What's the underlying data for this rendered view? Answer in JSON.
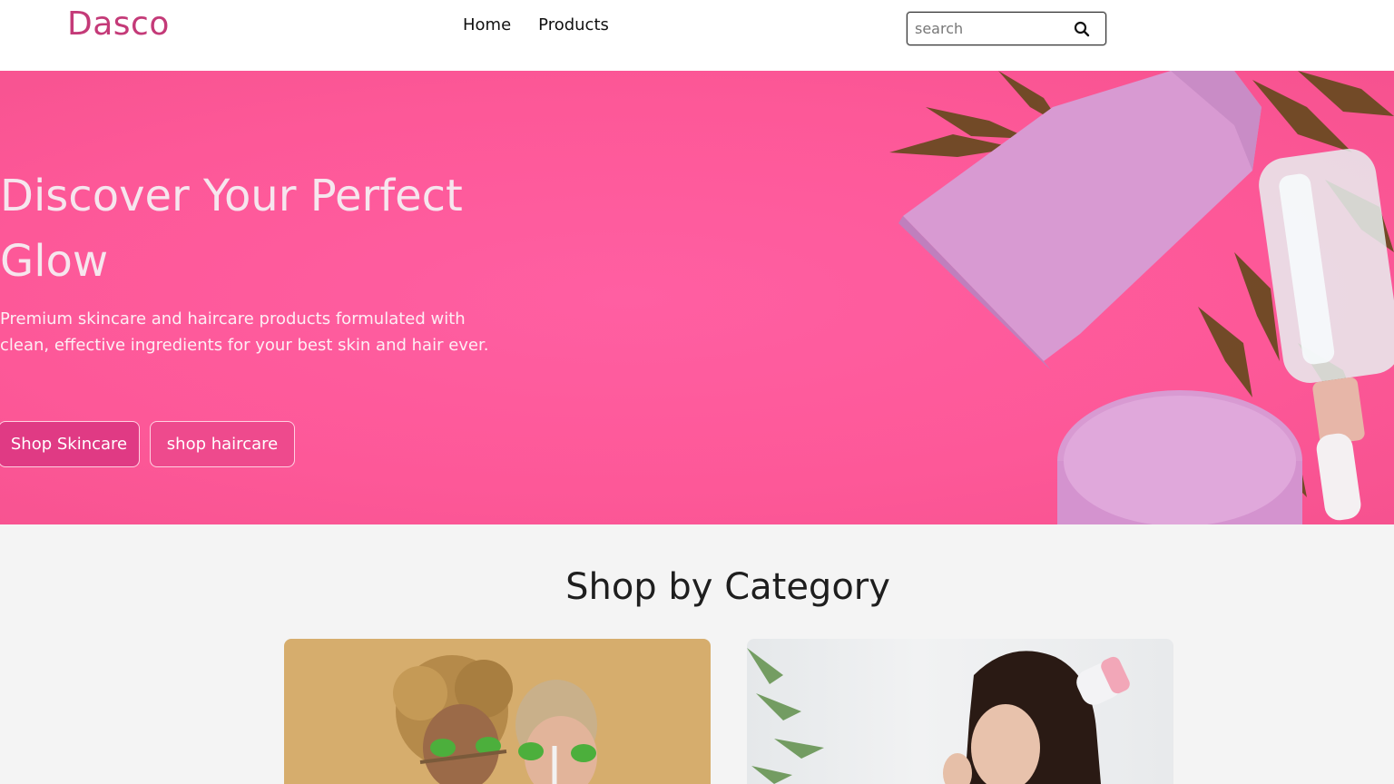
{
  "header": {
    "logo": "Dasco",
    "nav": [
      {
        "label": "Home"
      },
      {
        "label": "Products"
      }
    ],
    "search": {
      "placeholder": "search"
    }
  },
  "hero": {
    "title": "Discover Your Perfect Glow",
    "subtitle": "Premium skincare and haircare products formulated with clean, effective ingredients for your best skin and hair ever.",
    "buttons": [
      {
        "label": "Shop Skincare"
      },
      {
        "label": "shop haircare"
      }
    ]
  },
  "categories": {
    "title": "Shop by Category"
  },
  "colors": {
    "brand": "#c43a78",
    "hero_bg": "#fd5898",
    "button_primary": "#e03a84",
    "section_bg": "#f4f4f4"
  },
  "icons": {
    "search": "search-icon"
  }
}
